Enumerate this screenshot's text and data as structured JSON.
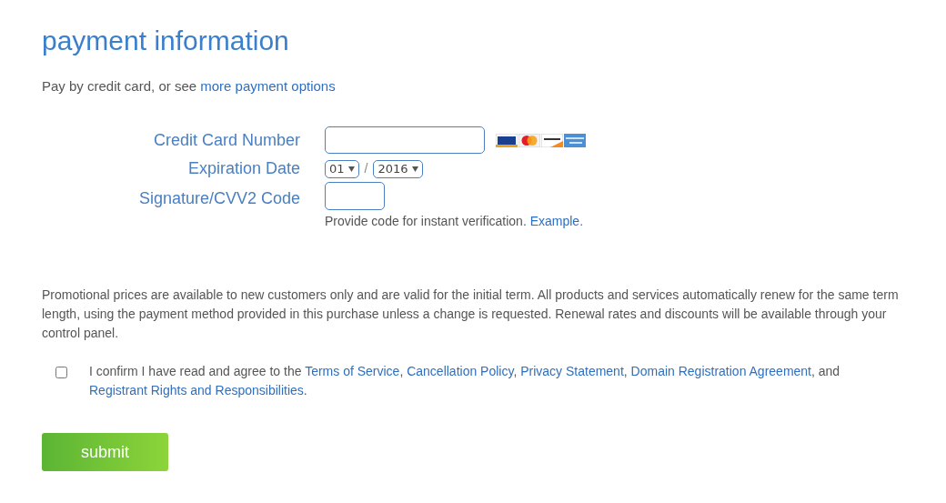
{
  "title": "payment information",
  "intro": {
    "text": "Pay by credit card, or see",
    "link": "more payment options"
  },
  "card_number": {
    "label": "Credit Card Number"
  },
  "expiration": {
    "label": "Expiration Date",
    "month": "01",
    "separator": "/",
    "year": "2016"
  },
  "cvv": {
    "label": "Signature/CVV2 Code",
    "help": "Provide code for instant verification.",
    "help_link": "Example."
  },
  "notice": "Promotional prices are available to new customers only and are valid for the initial term. All products and services automatically renew for the same term length, using the payment method provided in this purchase unless a change is requested. Renewal rates and discounts will be available through your control panel.",
  "agreement": {
    "checked": false,
    "parts": [
      {
        "kind": "text",
        "text": "I confirm I have read and agree to the "
      },
      {
        "kind": "link",
        "text": "Terms of Service"
      },
      {
        "kind": "text",
        "text": ", "
      },
      {
        "kind": "link",
        "text": "Cancellation Policy"
      },
      {
        "kind": "text",
        "text": ", "
      },
      {
        "kind": "link",
        "text": "Privacy Statement"
      },
      {
        "kind": "text",
        "text": ", "
      },
      {
        "kind": "link",
        "text": "Domain Registration Agreement"
      },
      {
        "kind": "text",
        "text": ", and "
      },
      {
        "kind": "link",
        "text": "Registrant Rights and Responsibilities"
      },
      {
        "kind": "text",
        "text": "."
      }
    ]
  },
  "submit": "submit"
}
